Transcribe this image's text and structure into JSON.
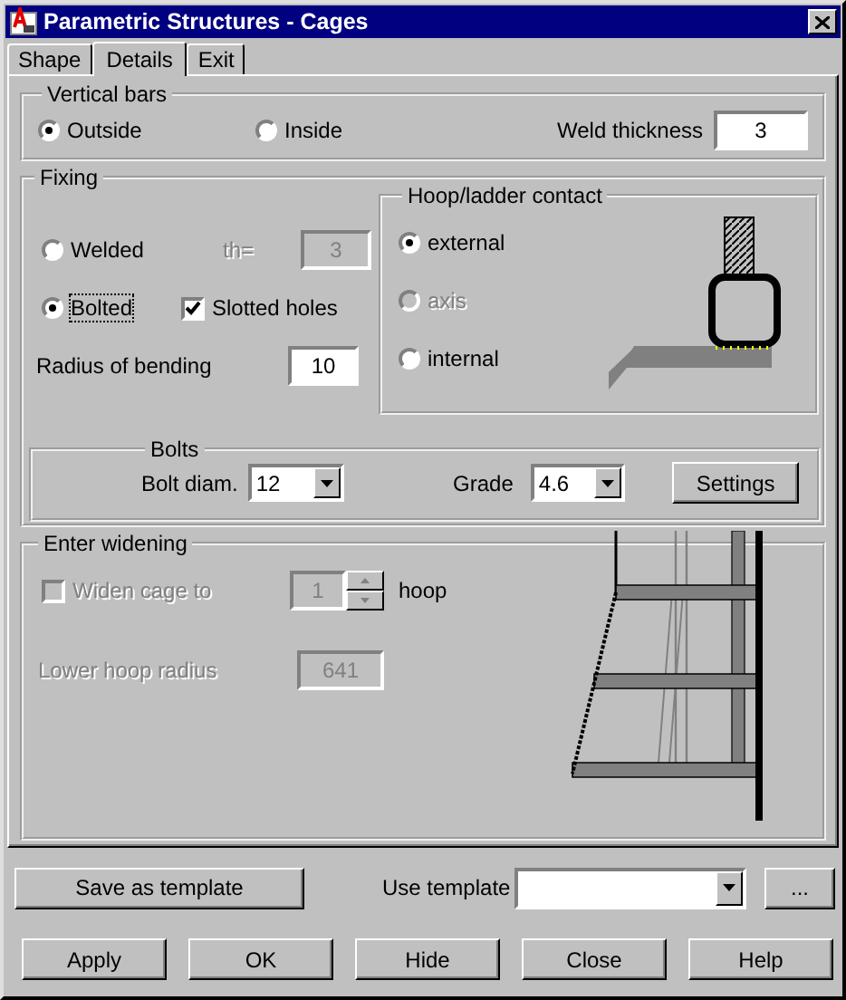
{
  "window": {
    "title": "Parametric Structures - Cages"
  },
  "tabs": [
    {
      "label": "Shape",
      "selected": false
    },
    {
      "label": "Details",
      "selected": true
    },
    {
      "label": "Exit",
      "selected": false
    }
  ],
  "vertical_bars": {
    "title": "Vertical bars",
    "options": [
      {
        "label": "Outside",
        "selected": true
      },
      {
        "label": "Inside",
        "selected": false
      }
    ],
    "weld_thickness": {
      "label": "Weld thickness",
      "value": "3"
    }
  },
  "fixing": {
    "title": "Fixing",
    "options": [
      {
        "label": "Welded",
        "selected": false,
        "focused": false
      },
      {
        "label": "Bolted",
        "selected": true,
        "focused": true
      }
    ],
    "th": {
      "label": "th=",
      "value": "3",
      "disabled": true
    },
    "slotted_holes": {
      "label": "Slotted holes",
      "checked": true
    },
    "radius": {
      "label": "Radius of bending",
      "value": "10"
    }
  },
  "contact": {
    "title": "Hoop/ladder contact",
    "options": [
      {
        "label": "external",
        "selected": true,
        "disabled": false
      },
      {
        "label": "axis",
        "selected": false,
        "disabled": true
      },
      {
        "label": "internal",
        "selected": false,
        "disabled": false
      }
    ]
  },
  "bolts": {
    "title": "Bolts",
    "diameter": {
      "label": "Bolt diam.",
      "value": "12"
    },
    "grade": {
      "label": "Grade",
      "value": "4.6"
    },
    "settings_button": "Settings"
  },
  "widening": {
    "title": "Enter widening",
    "widen": {
      "label": "Widen cage to",
      "checked": false,
      "disabled": true
    },
    "hoop_count": {
      "value": "1",
      "unit": "hoop",
      "disabled": true
    },
    "lower_radius": {
      "label": "Lower hoop radius",
      "value": "641",
      "disabled": true
    }
  },
  "template": {
    "save_button": "Save as template",
    "label": "Use template",
    "more_button": "..."
  },
  "buttons": [
    "Apply",
    "OK",
    "Hide",
    "Close",
    "Help"
  ]
}
